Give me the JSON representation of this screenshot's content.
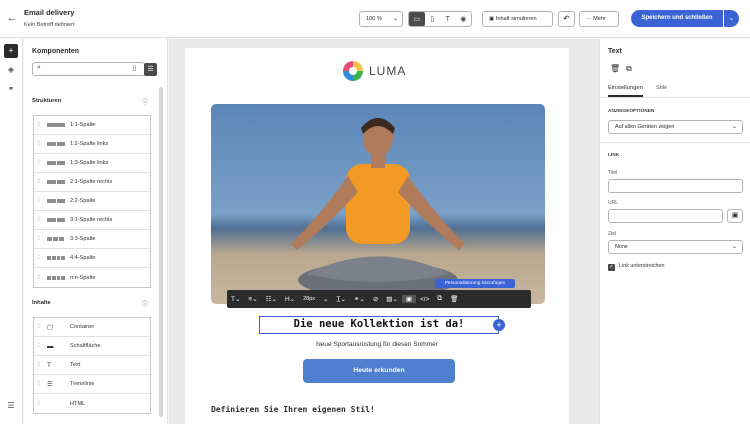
{
  "header": {
    "title": "Email delivery",
    "subtitle": "Kein Betreff definiert",
    "zoom": "100 %",
    "simulate_label": "Inhalt simulieren",
    "more_label": "Mehr",
    "save_label": "Speichern und schließen"
  },
  "left_panel": {
    "title": "Komponenten",
    "search_placeholder": "",
    "structures_title": "Strukturen",
    "structures": [
      {
        "label": "1:1-Spalte",
        "bars": 1
      },
      {
        "label": "1:2-Spalte links",
        "bars": 2
      },
      {
        "label": "1:3-Spalte links",
        "bars": 2
      },
      {
        "label": "2:1-Spalte rechts",
        "bars": 2
      },
      {
        "label": "2:2-Spalte",
        "bars": 2
      },
      {
        "label": "3:1-Spalte rechts",
        "bars": 2
      },
      {
        "label": "3:3-Spalte",
        "bars": 3
      },
      {
        "label": "4:4-Spalte",
        "bars": 4
      },
      {
        "label": "n:n-Spalte",
        "bars": 4
      }
    ],
    "content_title": "Inhalte",
    "contents": [
      {
        "label": "Container",
        "icon": "container-icon"
      },
      {
        "label": "Schaltfläche",
        "icon": "button-icon"
      },
      {
        "label": "Text",
        "icon": "text-icon"
      },
      {
        "label": "Trennlinie",
        "icon": "divider-icon"
      },
      {
        "label": "HTML",
        "icon": "html-icon"
      }
    ]
  },
  "email": {
    "logo_text": "LUMA",
    "tooltip": "Personalisierung hinzufügen",
    "font_size": "28px",
    "headline": "Die neue Kollektion ist da!",
    "subline": "Neue Sportausrüstung für diesen Sommer",
    "cta": "Heute erkunden",
    "section_title": "Definieren Sie Ihren eigenen Stil!"
  },
  "right_panel": {
    "title": "Text",
    "tab_settings": "Einstellungen",
    "tab_styles": "Stile",
    "display_options_label": "ANZEIGEOPTIONEN",
    "display_select": "Auf allen Geräten zeigen",
    "link_label": "LINK",
    "title_field_label": "Titel",
    "url_field_label": "URL",
    "target_label": "Ziel",
    "target_select": "None",
    "underline_label": "Link unterstreichen"
  },
  "colors": {
    "accent": "#3b63d6",
    "cta": "#4f7fce",
    "toolbar": "#2c2c2c"
  }
}
